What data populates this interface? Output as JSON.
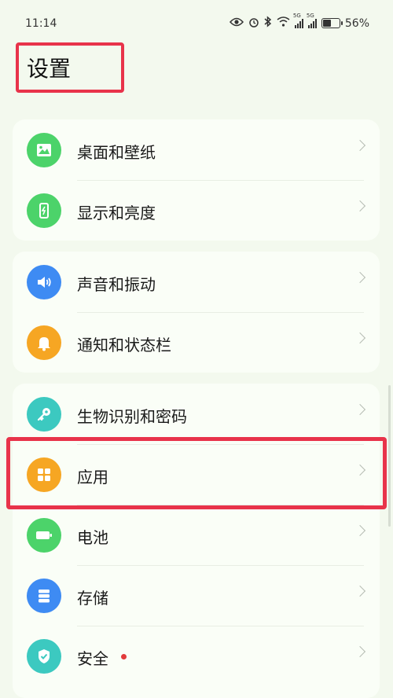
{
  "status_bar": {
    "time": "11:14",
    "battery": "56%",
    "battery_level": 0.56,
    "sim1": "5G",
    "sim2": "5G"
  },
  "page": {
    "title": "设置"
  },
  "groups": [
    {
      "items": [
        {
          "label": "桌面和壁纸",
          "icon": "wallpaper-icon",
          "color": "#4cd36a"
        },
        {
          "label": "显示和亮度",
          "icon": "display-brightness-icon",
          "color": "#4cd36a"
        }
      ]
    },
    {
      "items": [
        {
          "label": "声音和振动",
          "icon": "speaker-icon",
          "color": "#3e8bf3"
        },
        {
          "label": "通知和状态栏",
          "icon": "bell-icon",
          "color": "#f6a623"
        }
      ]
    },
    {
      "items": [
        {
          "label": "生物识别和密码",
          "icon": "key-icon",
          "color": "#3cc9c0"
        },
        {
          "label": "应用",
          "icon": "apps-grid-icon",
          "color": "#f6a623"
        },
        {
          "label": "电池",
          "icon": "battery-icon",
          "color": "#4cd36a"
        },
        {
          "label": "存储",
          "icon": "storage-icon",
          "color": "#3e8bf3"
        },
        {
          "label": "安全",
          "icon": "shield-check-icon",
          "color": "#3cc9c0",
          "badge": "red-dot"
        }
      ]
    }
  ],
  "colors": {
    "highlight": "#e8334a",
    "background": "#f3f9ee"
  }
}
